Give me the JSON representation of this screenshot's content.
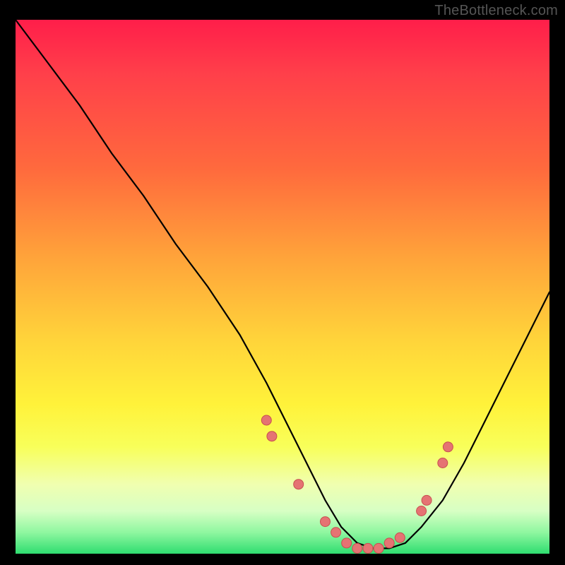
{
  "watermark": "TheBottleneck.com",
  "colors": {
    "frame_bg": "#000000",
    "watermark": "#555555",
    "curve_stroke": "#000000",
    "marker_fill": "#e57373",
    "marker_stroke": "#c84f4f",
    "gradient_top": "#ff1e4a",
    "gradient_bottom": "#2fdd70"
  },
  "chart_data": {
    "type": "line",
    "title": "",
    "xlabel": "",
    "ylabel": "",
    "xlim": [
      0,
      100
    ],
    "ylim": [
      0,
      100
    ],
    "grid": false,
    "legend": false,
    "series": [
      {
        "name": "bottleneck-curve",
        "x": [
          0,
          6,
          12,
          18,
          24,
          30,
          36,
          42,
          47,
          51,
          55,
          58,
          61,
          64,
          67,
          70,
          73,
          76,
          80,
          84,
          88,
          92,
          96,
          100
        ],
        "values": [
          100,
          92,
          84,
          75,
          67,
          58,
          50,
          41,
          32,
          24,
          16,
          10,
          5,
          2,
          1,
          1,
          2,
          5,
          10,
          17,
          25,
          33,
          41,
          49
        ]
      }
    ],
    "markers": {
      "name": "threshold-dots",
      "x": [
        47,
        48,
        53,
        58,
        60,
        62,
        64,
        66,
        68,
        70,
        72,
        76,
        77,
        80,
        81
      ],
      "values": [
        25,
        22,
        13,
        6,
        4,
        2,
        1,
        1,
        1,
        2,
        3,
        8,
        10,
        17,
        20
      ]
    }
  }
}
